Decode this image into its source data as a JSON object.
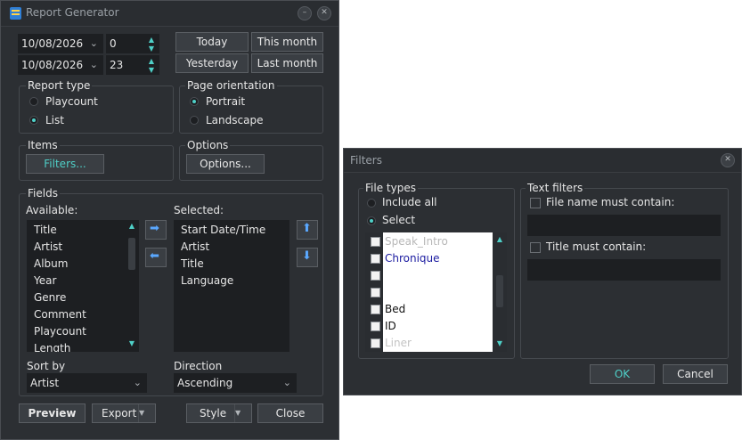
{
  "report": {
    "title": "Report Generator",
    "date_from": "10/08/2026",
    "date_to": "10/08/2026",
    "hour_from": "0",
    "hour_to": "23",
    "quick": {
      "today": "Today",
      "this_month": "This month",
      "yesterday": "Yesterday",
      "last_month": "Last month"
    },
    "report_type": {
      "label": "Report type",
      "playcount": "Playcount",
      "list": "List"
    },
    "orientation": {
      "label": "Page orientation",
      "portrait": "Portrait",
      "landscape": "Landscape"
    },
    "items": {
      "label": "Items",
      "filters_button": "Filters..."
    },
    "options": {
      "label": "Options",
      "options_button": "Options..."
    },
    "fields": {
      "label": "Fields",
      "available_label": "Available:",
      "selected_label": "Selected:",
      "available": [
        "Title",
        "Artist",
        "Album",
        "Year",
        "Genre",
        "Comment",
        "Playcount",
        "Length"
      ],
      "selected": [
        "Start Date/Time",
        "Artist",
        "Title",
        "Language"
      ]
    },
    "sort_by": {
      "label": "Sort by",
      "value": "Artist"
    },
    "direction": {
      "label": "Direction",
      "value": "Ascending"
    },
    "buttons": {
      "preview": "Preview",
      "export": "Export",
      "style": "Style",
      "close": "Close"
    }
  },
  "filters": {
    "title": "Filters",
    "file_types": {
      "label": "File types",
      "include_all": "Include all",
      "select": "Select",
      "items": [
        {
          "label": "Speak_Intro",
          "style": "faded"
        },
        {
          "label": "Chronique",
          "style": "blue"
        },
        {
          "label": "",
          "style": "normal"
        },
        {
          "label": "",
          "style": "normal"
        },
        {
          "label": "Bed",
          "style": "normal"
        },
        {
          "label": "ID",
          "style": "normal"
        },
        {
          "label": "Liner",
          "style": "faded"
        }
      ]
    },
    "text_filters": {
      "label": "Text filters",
      "file_name": "File name must contain:",
      "title": "Title must contain:"
    },
    "ok": "OK",
    "cancel": "Cancel"
  },
  "colors": {
    "accent": "#4fd0c8",
    "window_bg": "#2c2f33",
    "field_bg": "#1d1f22",
    "blue_text": "#1a1aa0"
  }
}
